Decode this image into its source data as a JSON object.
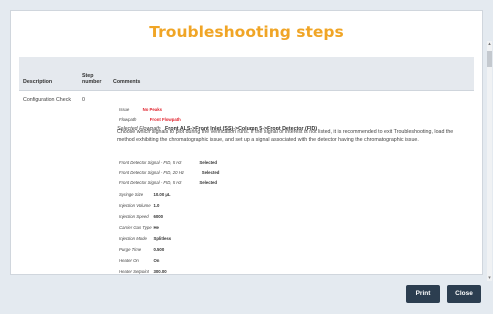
{
  "dialog": {
    "title": "Troubleshooting steps",
    "columns": {
      "description": "Description",
      "step_number": "Step number",
      "comments": "Comments"
    },
    "row": {
      "description": "Configuration Check",
      "step": "0",
      "issue_label": "Issue",
      "issue_value": "No Peaks",
      "flowpath_label": "Flowpath",
      "flowpath_value": "Front Flowpath",
      "selected_flowpath_label": "Selected Flowpath",
      "selected_flowpath_value": "Front ALS->Front Inlet (SS)->Column 5->Front Detector (FID)",
      "instruction": "Choose which signals to plot during the verification runs. If the signal of interest is not listed, it is recommended to exit Troubleshooting, load the method exhibiting the chromatographic issue, and set up a signal associated with the detector having the chromatographic issue.",
      "signals": [
        {
          "label": "Front Detector Signal - FID, 5 Hz",
          "value": "Selected"
        },
        {
          "label": "Front Detector Signal - FID, 20 Hz",
          "value": "Selected"
        },
        {
          "label": "Front Detector Signal - FID, 5 Hz",
          "value": "Selected"
        }
      ],
      "params": [
        {
          "label": "Syringe Size",
          "value": "10.00 µL"
        },
        {
          "label": "Injection Volume",
          "value": "1.0"
        },
        {
          "label": "Injection Speed",
          "value": "6000"
        },
        {
          "label": "Carrier Gas Type",
          "value": "He"
        },
        {
          "label": "Injection Mode",
          "value": "Splitless"
        },
        {
          "label": "Purge Time",
          "value": "0.500"
        },
        {
          "label": "Heater On",
          "value": "On"
        },
        {
          "label": "Heater Setpoint",
          "value": "300.00"
        }
      ]
    }
  },
  "buttons": {
    "print": "Print",
    "close": "Close"
  },
  "colors": {
    "title": "#f0a526",
    "highlight_red": "#e0202b",
    "button_bg": "#2c3e50"
  }
}
